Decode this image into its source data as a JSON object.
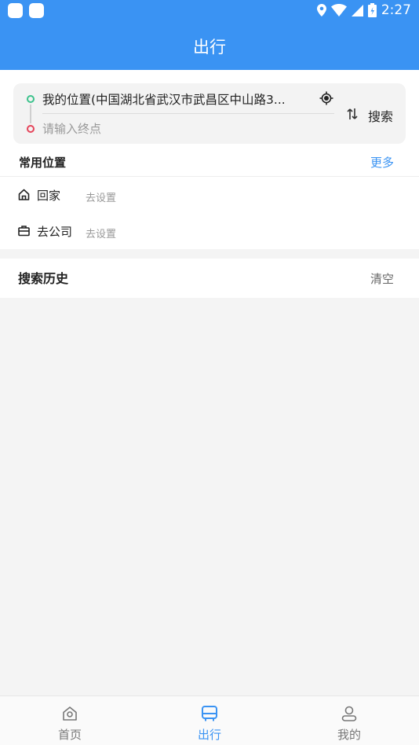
{
  "status_bar": {
    "time": "2:27"
  },
  "app_bar": {
    "title": "出行"
  },
  "search": {
    "start_location": "我的位置(中国湖北省武汉市武昌区中山路3...",
    "destination_placeholder": "请输入终点",
    "destination_value": "",
    "search_label": "搜索"
  },
  "common_places": {
    "title": "常用位置",
    "more_label": "更多",
    "items": [
      {
        "name": "回家",
        "action": "去设置",
        "icon": "home-icon"
      },
      {
        "name": "去公司",
        "action": "去设置",
        "icon": "briefcase-icon"
      }
    ]
  },
  "history": {
    "title": "搜索历史",
    "clear_label": "清空"
  },
  "bottom_nav": {
    "items": [
      {
        "label": "首页",
        "icon": "home-icon",
        "active": false
      },
      {
        "label": "出行",
        "icon": "bus-icon",
        "active": true
      },
      {
        "label": "我的",
        "icon": "person-icon",
        "active": false
      }
    ]
  },
  "colors": {
    "primary": "#3a93f3",
    "start_dot": "#3cc28c",
    "end_dot": "#e5445a"
  }
}
